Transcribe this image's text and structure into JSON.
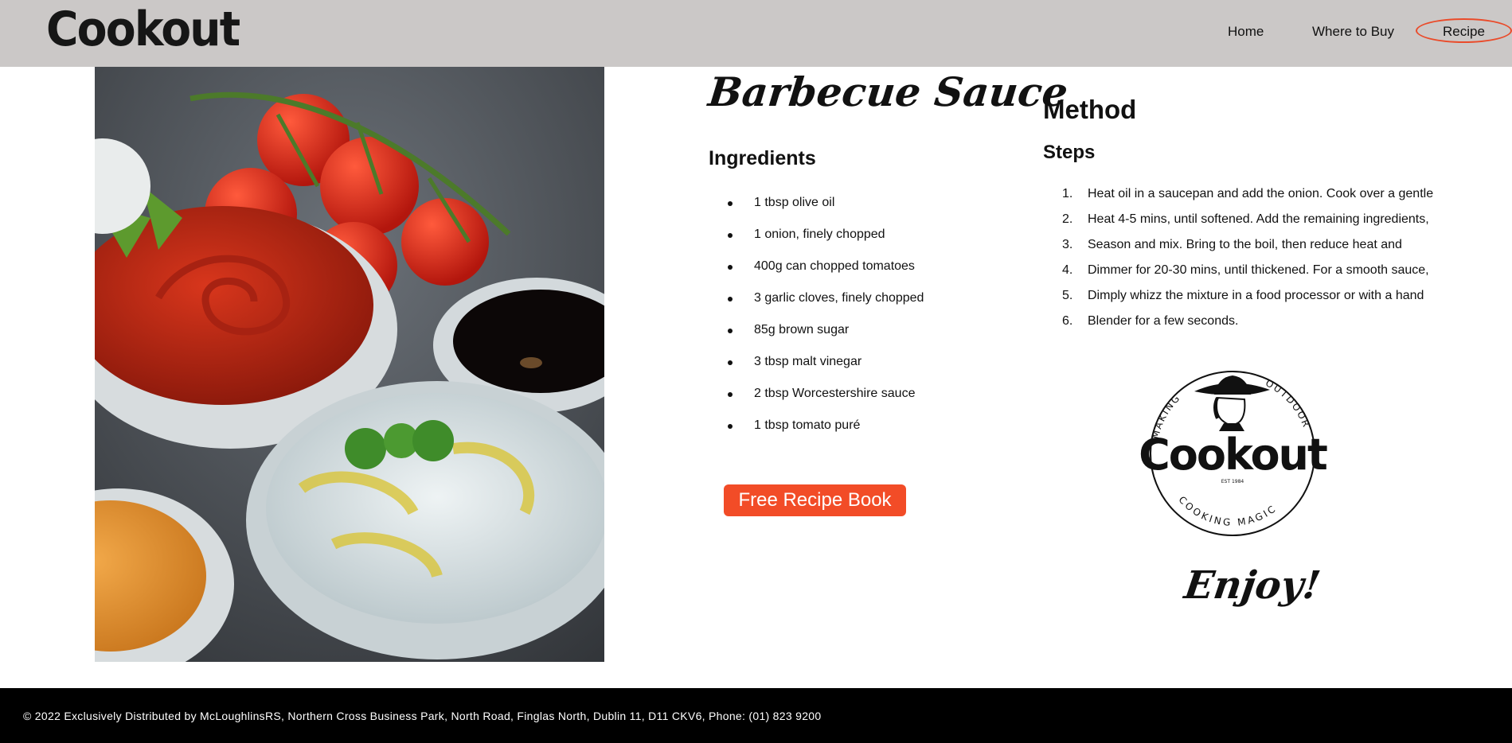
{
  "header": {
    "brand": "Cookout",
    "nav": [
      {
        "label": "Home"
      },
      {
        "label": "Where to Buy"
      },
      {
        "label": "Recipe",
        "active": true
      }
    ]
  },
  "recipe": {
    "title": "Barbecue Sauce",
    "ingredients_heading": "Ingredients",
    "ingredients": [
      "1 tbsp olive oil",
      "1 onion, finely chopped",
      "400g can chopped tomatoes",
      "3 garlic cloves, finely chopped",
      "85g brown sugar",
      "3 tbsp malt vinegar",
      "2 tbsp Worcestershire sauce",
      "1 tbsp tomato puré"
    ],
    "button_label": "Free Recipe Book",
    "method_heading": "Method",
    "steps_heading": "Steps",
    "steps": [
      {
        "num": "1.",
        "text": "Heat oil in a saucepan and add the onion. Cook over a gentle"
      },
      {
        "num": "2.",
        "text": "Heat 4-5 mins, until softened. Add the remaining ingredients,"
      },
      {
        "num": "3.",
        "text": "Season and mix. Bring to the boil, then reduce heat and"
      },
      {
        "num": "4.",
        "text": "Dimmer for 20-30 mins, until thickened. For a smooth sauce,"
      },
      {
        "num": "5.",
        "text": "Dimply whizz the mixture in a food processor or with a hand"
      },
      {
        "num": "6.",
        "text": "Blender for a few seconds."
      }
    ],
    "closing": "Enjoy!"
  },
  "logo": {
    "arc_top_left": "MAKING",
    "arc_top_right": "OUTDOOR",
    "wordmark": "Cookout",
    "est": "EST 1984",
    "arc_bottom": "COOKING MAGIC"
  },
  "footer": {
    "text": "© 2022 Exclusively Distributed by McLoughlinsRS, Northern Cross Business Park, North Road, Finglas North, Dublin 11, D11 CKV6, Phone: (01) 823 9200"
  },
  "colors": {
    "header_bg": "#cbc8c7",
    "accent": "#f24c27",
    "footer_bg": "#000000"
  }
}
